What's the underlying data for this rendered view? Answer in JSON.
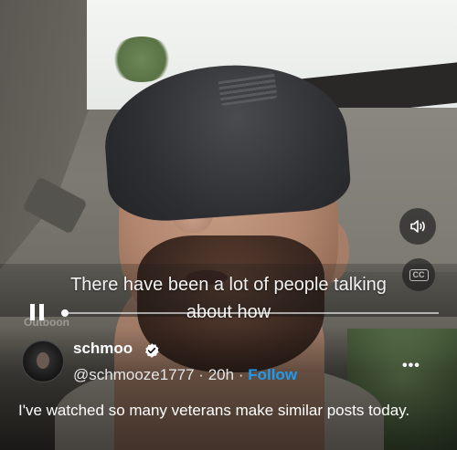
{
  "video": {
    "caption_line1": "There have been a lot of people talking",
    "caption_line2": "about how",
    "watermark": "Outboon",
    "progress": 0.0,
    "state": "playing",
    "volume_icon": "speaker-icon",
    "cc_label": "CC"
  },
  "tweet": {
    "display_name": "schmoo",
    "verified": true,
    "handle": "@schmooze1777",
    "separator1": "·",
    "time": "20h",
    "separator2": "·",
    "follow_label": "Follow",
    "more_icon": "more-options-icon",
    "text": "I've watched so many veterans make similar posts today."
  },
  "colors": {
    "accent": "#1d9bf0",
    "text_primary": "#ffffff"
  }
}
